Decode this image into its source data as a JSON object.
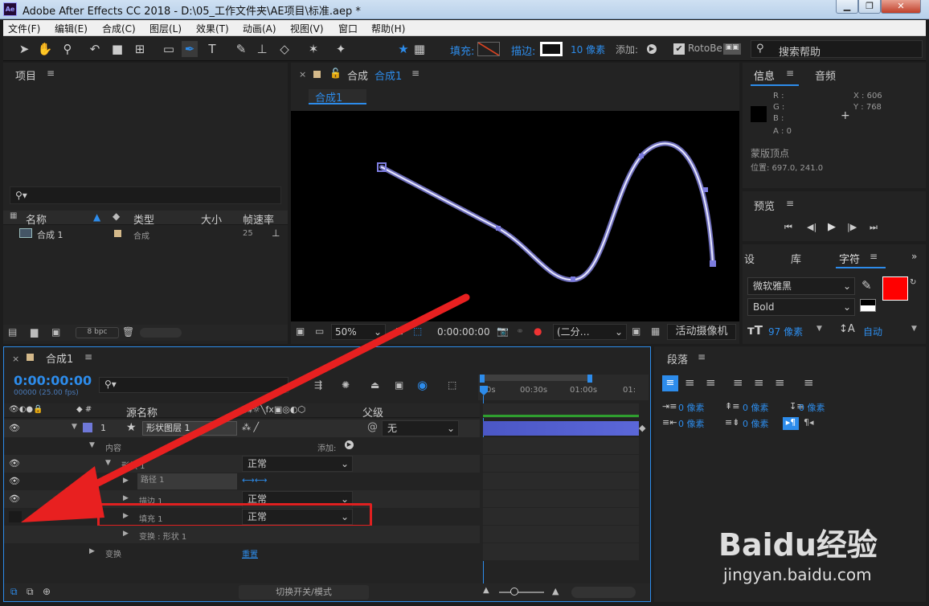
{
  "window": {
    "title": "Adobe After Effects CC 2018 - D:\\05_工作文件夹\\AE项目\\标准.aep *",
    "icon_text": "Ae"
  },
  "menu": [
    "文件(F)",
    "编辑(E)",
    "合成(C)",
    "图层(L)",
    "效果(T)",
    "动画(A)",
    "视图(V)",
    "窗口",
    "帮助(H)"
  ],
  "toolbar": {
    "fill_label": "填充:",
    "stroke_label": "描边:",
    "stroke_size": "10 像素",
    "add_label": "添加:",
    "rotobezier": "RotoBe",
    "search_placeholder": "搜索帮助"
  },
  "project": {
    "title": "项目",
    "columns": [
      "名称",
      "类型",
      "大小",
      "帧速率"
    ],
    "items": [
      {
        "name": "合成 1",
        "type": "合成",
        "fps": "25"
      }
    ],
    "bpc": "8 bpc"
  },
  "comp": {
    "title_prefix": "合成",
    "title_name": "合成1",
    "tab": "合成1",
    "zoom": "50%",
    "time": "0:00:00:00",
    "resolution": "(二分…",
    "camera": "活动摄像机"
  },
  "info": {
    "tab1": "信息",
    "tab2": "音频",
    "r": "R :",
    "g": "G :",
    "b": "B :",
    "a": "A : 0",
    "x": "X : 606",
    "y": "Y : 768",
    "desc1": "蒙版顶点",
    "desc2": "位置: 697.0, 241.0"
  },
  "preview": {
    "title": "预览"
  },
  "char": {
    "tab1": "设",
    "tab2": "库",
    "tab3": "字符",
    "font": "微软雅黑",
    "style": "Bold",
    "size": "97 像素",
    "leading": "自动",
    "color_fill": "#ff0000"
  },
  "timeline": {
    "title": "合成1",
    "timecode": "0:00:00:00",
    "fps": "00000 (25.00 fps)",
    "col_source": "源名称",
    "col_parent": "父级",
    "ruler": [
      "0s",
      "00:30s",
      "01:00s",
      "01:"
    ],
    "layers": [
      {
        "num": "1",
        "name": "形状图层 1",
        "parent": "无"
      },
      {
        "name": "内容",
        "add": "添加:"
      },
      {
        "name": "形状 1",
        "mode": "正常"
      },
      {
        "name": "路径 1"
      },
      {
        "name": "描边 1",
        "mode": "正常"
      },
      {
        "name": "填充 1",
        "mode": "正常"
      },
      {
        "name": "变换 : 形状 1"
      },
      {
        "name": "变换",
        "reset": "重置"
      }
    ],
    "footer": "切换开关/模式"
  },
  "paragraph": {
    "title": "段落",
    "indent_values": [
      "0 像素",
      "0 像素",
      "0 像素",
      "0 像素",
      "0 像素"
    ]
  },
  "watermark": {
    "brand": "Baidu经验",
    "url": "jingyan.baidu.com"
  }
}
